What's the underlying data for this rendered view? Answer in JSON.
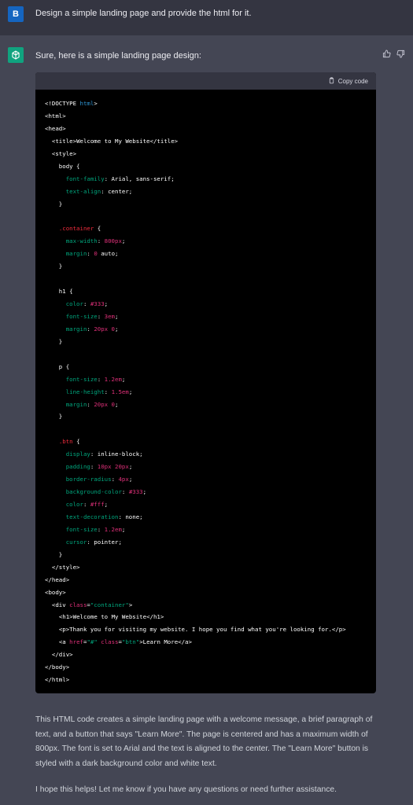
{
  "user": {
    "avatar_letter": "B",
    "message": "Design a simple landing page and provide the html for it."
  },
  "assistant": {
    "intro": "Sure, here is a simple landing page design:",
    "copy_label": "Copy code",
    "code_lines": [
      [
        [
          "c-tag",
          "<!DOCTYPE "
        ],
        [
          "c-kw",
          "html"
        ],
        [
          "c-tag",
          ">"
        ]
      ],
      [
        [
          "c-tag",
          "<html>"
        ]
      ],
      [
        [
          "c-tag",
          "<head>"
        ]
      ],
      [
        [
          "c-plain",
          "  "
        ],
        [
          "c-tag",
          "<title>"
        ],
        [
          "c-plain",
          "Welcome to My Website"
        ],
        [
          "c-tag",
          "</title>"
        ]
      ],
      [
        [
          "c-plain",
          "  "
        ],
        [
          "c-tag",
          "<style>"
        ]
      ],
      [
        [
          "c-plain",
          "    body {"
        ]
      ],
      [
        [
          "c-plain",
          "      "
        ],
        [
          "c-prop",
          "font-family"
        ],
        [
          "c-plain",
          ": Arial, sans-serif;"
        ]
      ],
      [
        [
          "c-plain",
          "      "
        ],
        [
          "c-prop",
          "text-align"
        ],
        [
          "c-plain",
          ": center;"
        ]
      ],
      [
        [
          "c-plain",
          "    }"
        ]
      ],
      [
        [
          "c-plain",
          ""
        ]
      ],
      [
        [
          "c-plain",
          "    "
        ],
        [
          "c-sel",
          ".container"
        ],
        [
          "c-plain",
          " {"
        ]
      ],
      [
        [
          "c-plain",
          "      "
        ],
        [
          "c-prop",
          "max-width"
        ],
        [
          "c-plain",
          ": "
        ],
        [
          "c-num",
          "800px"
        ],
        [
          "c-plain",
          ";"
        ]
      ],
      [
        [
          "c-plain",
          "      "
        ],
        [
          "c-prop",
          "margin"
        ],
        [
          "c-plain",
          ": "
        ],
        [
          "c-num",
          "0"
        ],
        [
          "c-plain",
          " auto;"
        ]
      ],
      [
        [
          "c-plain",
          "    }"
        ]
      ],
      [
        [
          "c-plain",
          ""
        ]
      ],
      [
        [
          "c-plain",
          "    h1 {"
        ]
      ],
      [
        [
          "c-plain",
          "      "
        ],
        [
          "c-prop",
          "color"
        ],
        [
          "c-plain",
          ": "
        ],
        [
          "c-num",
          "#333"
        ],
        [
          "c-plain",
          ";"
        ]
      ],
      [
        [
          "c-plain",
          "      "
        ],
        [
          "c-prop",
          "font-size"
        ],
        [
          "c-plain",
          ": "
        ],
        [
          "c-num",
          "3em"
        ],
        [
          "c-plain",
          ";"
        ]
      ],
      [
        [
          "c-plain",
          "      "
        ],
        [
          "c-prop",
          "margin"
        ],
        [
          "c-plain",
          ": "
        ],
        [
          "c-num",
          "20px 0"
        ],
        [
          "c-plain",
          ";"
        ]
      ],
      [
        [
          "c-plain",
          "    }"
        ]
      ],
      [
        [
          "c-plain",
          ""
        ]
      ],
      [
        [
          "c-plain",
          "    p {"
        ]
      ],
      [
        [
          "c-plain",
          "      "
        ],
        [
          "c-prop",
          "font-size"
        ],
        [
          "c-plain",
          ": "
        ],
        [
          "c-num",
          "1.2em"
        ],
        [
          "c-plain",
          ";"
        ]
      ],
      [
        [
          "c-plain",
          "      "
        ],
        [
          "c-prop",
          "line-height"
        ],
        [
          "c-plain",
          ": "
        ],
        [
          "c-num",
          "1.5em"
        ],
        [
          "c-plain",
          ";"
        ]
      ],
      [
        [
          "c-plain",
          "      "
        ],
        [
          "c-prop",
          "margin"
        ],
        [
          "c-plain",
          ": "
        ],
        [
          "c-num",
          "20px 0"
        ],
        [
          "c-plain",
          ";"
        ]
      ],
      [
        [
          "c-plain",
          "    }"
        ]
      ],
      [
        [
          "c-plain",
          ""
        ]
      ],
      [
        [
          "c-plain",
          "    "
        ],
        [
          "c-sel",
          ".btn"
        ],
        [
          "c-plain",
          " {"
        ]
      ],
      [
        [
          "c-plain",
          "      "
        ],
        [
          "c-prop",
          "display"
        ],
        [
          "c-plain",
          ": inline-block;"
        ]
      ],
      [
        [
          "c-plain",
          "      "
        ],
        [
          "c-prop",
          "padding"
        ],
        [
          "c-plain",
          ": "
        ],
        [
          "c-num",
          "10px 20px"
        ],
        [
          "c-plain",
          ";"
        ]
      ],
      [
        [
          "c-plain",
          "      "
        ],
        [
          "c-prop",
          "border-radius"
        ],
        [
          "c-plain",
          ": "
        ],
        [
          "c-num",
          "4px"
        ],
        [
          "c-plain",
          ";"
        ]
      ],
      [
        [
          "c-plain",
          "      "
        ],
        [
          "c-prop",
          "background-color"
        ],
        [
          "c-plain",
          ": "
        ],
        [
          "c-num",
          "#333"
        ],
        [
          "c-plain",
          ";"
        ]
      ],
      [
        [
          "c-plain",
          "      "
        ],
        [
          "c-prop",
          "color"
        ],
        [
          "c-plain",
          ": "
        ],
        [
          "c-num",
          "#fff"
        ],
        [
          "c-plain",
          ";"
        ]
      ],
      [
        [
          "c-plain",
          "      "
        ],
        [
          "c-prop",
          "text-decoration"
        ],
        [
          "c-plain",
          ": none;"
        ]
      ],
      [
        [
          "c-plain",
          "      "
        ],
        [
          "c-prop",
          "font-size"
        ],
        [
          "c-plain",
          ": "
        ],
        [
          "c-num",
          "1.2em"
        ],
        [
          "c-plain",
          ";"
        ]
      ],
      [
        [
          "c-plain",
          "      "
        ],
        [
          "c-prop",
          "cursor"
        ],
        [
          "c-plain",
          ": pointer;"
        ]
      ],
      [
        [
          "c-plain",
          "    }"
        ]
      ],
      [
        [
          "c-plain",
          "  "
        ],
        [
          "c-tag",
          "</style>"
        ]
      ],
      [
        [
          "c-tag",
          "</head>"
        ]
      ],
      [
        [
          "c-tag",
          "<body>"
        ]
      ],
      [
        [
          "c-plain",
          "  "
        ],
        [
          "c-tag",
          "<div "
        ],
        [
          "c-attr",
          "class"
        ],
        [
          "c-plain",
          "="
        ],
        [
          "c-str",
          "\"container\""
        ],
        [
          "c-tag",
          ">"
        ]
      ],
      [
        [
          "c-plain",
          "    "
        ],
        [
          "c-tag",
          "<h1>"
        ],
        [
          "c-plain",
          "Welcome to My Website"
        ],
        [
          "c-tag",
          "</h1>"
        ]
      ],
      [
        [
          "c-plain",
          "    "
        ],
        [
          "c-tag",
          "<p>"
        ],
        [
          "c-plain",
          "Thank you for visiting my website. I hope you find what you're looking for."
        ],
        [
          "c-tag",
          "</p>"
        ]
      ],
      [
        [
          "c-plain",
          "    "
        ],
        [
          "c-tag",
          "<a "
        ],
        [
          "c-attr",
          "href"
        ],
        [
          "c-plain",
          "="
        ],
        [
          "c-str",
          "\"#\""
        ],
        [
          "c-plain",
          " "
        ],
        [
          "c-attr",
          "class"
        ],
        [
          "c-plain",
          "="
        ],
        [
          "c-str",
          "\"btn\""
        ],
        [
          "c-tag",
          ">"
        ],
        [
          "c-plain",
          "Learn More"
        ],
        [
          "c-tag",
          "</a>"
        ]
      ],
      [
        [
          "c-plain",
          "  "
        ],
        [
          "c-tag",
          "</div>"
        ]
      ],
      [
        [
          "c-tag",
          "</body>"
        ]
      ],
      [
        [
          "c-tag",
          "</html>"
        ]
      ]
    ],
    "paragraph1": "This HTML code creates a simple landing page with a welcome message, a brief paragraph of text, and a button that says \"Learn More\". The page is centered and has a maximum width of 800px. The font is set to Arial and the text is aligned to the center. The \"Learn More\" button is styled with a dark background color and white text.",
    "paragraph2": "I hope this helps! Let me know if you have any questions or need further assistance."
  },
  "colors": {
    "user_bg": "#343541",
    "assistant_bg": "#444654",
    "avatar_user": "#1565c0",
    "avatar_bot": "#10a37f",
    "code_bg": "#000000"
  },
  "icons": {
    "bot_avatar": "openai-logo-icon",
    "copy": "clipboard-icon",
    "like": "thumbs-up-icon",
    "dislike": "thumbs-down-icon"
  }
}
